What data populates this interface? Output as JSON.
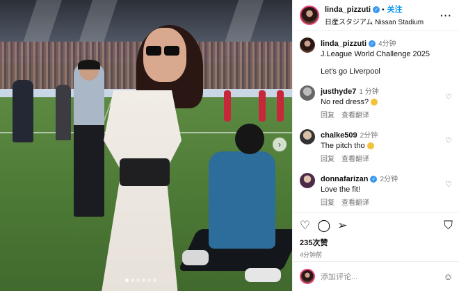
{
  "post": {
    "username": "linda_pizzuti",
    "follow_label": "关注",
    "location": "日産スタジアム Nissan Stadium",
    "more_icon": "more-dots-icon"
  },
  "caption": {
    "username": "linda_pizzuti",
    "time": "4分钟",
    "line1": "J.League World Challenge 2025",
    "line2": "Let's go Liverpool"
  },
  "comments": [
    {
      "username": "justhyde7",
      "time": "1 分钟",
      "text": "No red dress?",
      "reply": "回复",
      "translate": "查看翻译"
    },
    {
      "username": "chalke509",
      "time": "2分钟",
      "text": "The pitch tho",
      "reply": "回复",
      "translate": "查看翻译"
    },
    {
      "username": "donnafarizan",
      "time": "2分钟",
      "text": "Love the fit!",
      "reply": "回复",
      "translate": "查看翻译"
    }
  ],
  "stats": {
    "likes": "235次赞",
    "posted_ago": "4分钟前"
  },
  "composer": {
    "placeholder": "添加评论..."
  },
  "colors": {
    "accent": "#0095f6",
    "verified": "#3897f0",
    "story_ring": "#e7447a"
  }
}
